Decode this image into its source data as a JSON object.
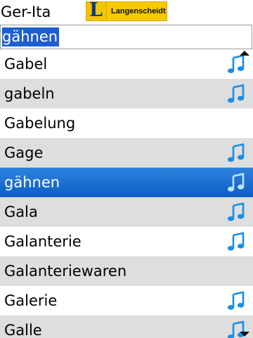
{
  "header": {
    "title": "Ger-Ita",
    "logo": {
      "text": "Langenscheidt",
      "mark": "L"
    }
  },
  "search": {
    "value": "gähnen"
  },
  "list": {
    "items": [
      {
        "label": "Gabel",
        "audio": true
      },
      {
        "label": "gabeln",
        "audio": true
      },
      {
        "label": "Gabelung",
        "audio": false
      },
      {
        "label": "Gage",
        "audio": true
      },
      {
        "label": "gähnen",
        "audio": true,
        "selected": true
      },
      {
        "label": "Gala",
        "audio": true
      },
      {
        "label": "Galanterie",
        "audio": true
      },
      {
        "label": "Galanteriewaren",
        "audio": false
      },
      {
        "label": "Galerie",
        "audio": true
      },
      {
        "label": "Galle",
        "audio": true
      }
    ]
  },
  "colors": {
    "selection": "#1d5fd0",
    "alt_row": "#dedede",
    "icon_blue": "#1a8ee6",
    "logo_yellow": "#f7c900"
  },
  "icons": {
    "audio": "music-note-icon",
    "scroll_up": "scroll-up-arrow-icon",
    "scroll_down": "scroll-down-arrow-icon"
  }
}
